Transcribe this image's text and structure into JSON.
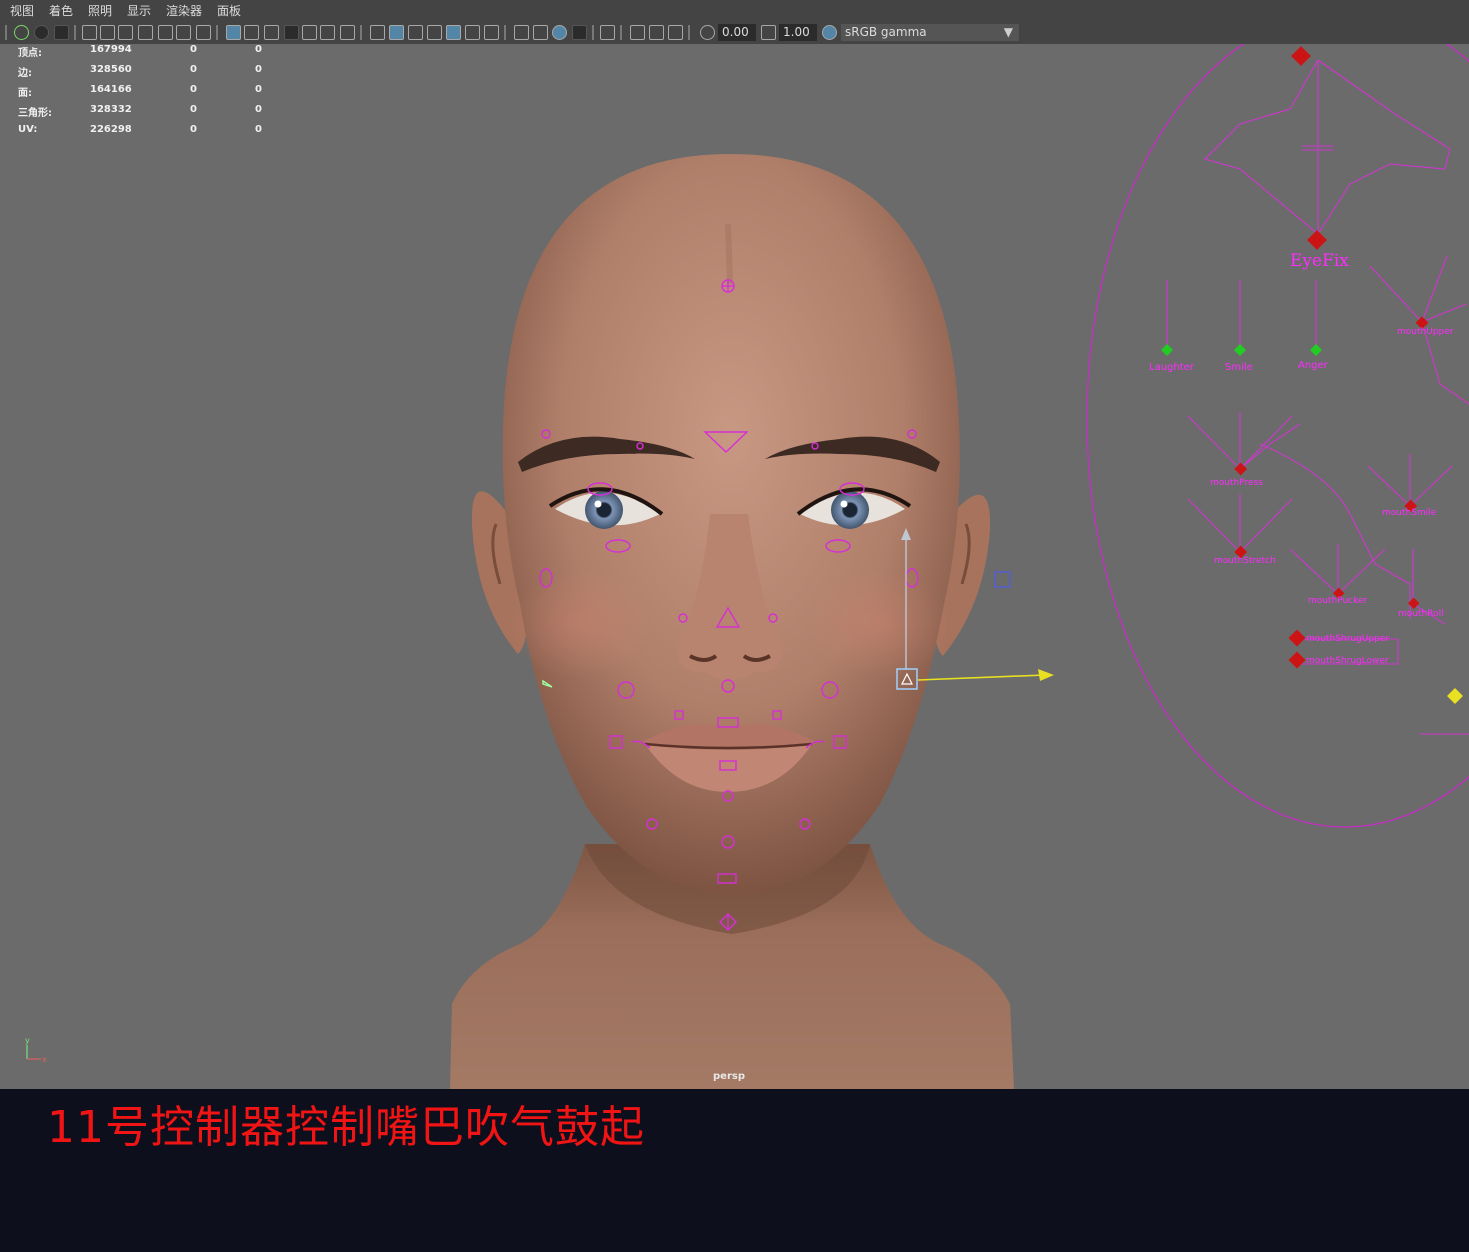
{
  "menu": [
    "视图",
    "着色",
    "照明",
    "显示",
    "渲染器",
    "面板"
  ],
  "toolbar": {
    "exposure": "0.00",
    "gamma": "1.00",
    "color_space": "sRGB gamma"
  },
  "hud": {
    "rows": [
      {
        "label": "顶点:",
        "v1": "167994",
        "v2": "0",
        "v3": "0"
      },
      {
        "label": "边:",
        "v1": "328560",
        "v2": "0",
        "v3": "0"
      },
      {
        "label": "面:",
        "v1": "164166",
        "v2": "0",
        "v3": "0"
      },
      {
        "label": "三角形:",
        "v1": "328332",
        "v2": "0",
        "v3": "0"
      },
      {
        "label": "UV:",
        "v1": "226298",
        "v2": "0",
        "v3": "0"
      }
    ]
  },
  "camera": "persp",
  "rig": {
    "panel_title": "EyeFix",
    "controls": [
      "Laughter",
      "Smile",
      "Anger"
    ]
  },
  "axis": {
    "y": "y",
    "x": "x"
  },
  "caption": "11号控制器控制嘴巴吹气鼓起",
  "colors": {
    "control": "#d62ed6",
    "selected": "#9fd0ff",
    "caption": "#f01414",
    "background": "#6b6b6b"
  }
}
